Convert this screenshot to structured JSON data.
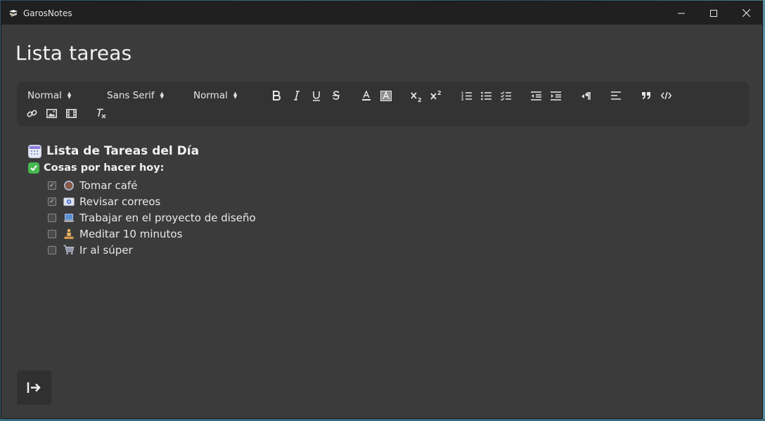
{
  "window": {
    "app_name": "GarosNotes",
    "controls": [
      "minimize",
      "maximize",
      "close"
    ]
  },
  "page_title": "Lista tareas",
  "toolbar": {
    "header_select": "Normal",
    "font_select": "Sans Serif",
    "size_select": "Normal",
    "row1_icons": [
      "bold-icon",
      "italic-icon",
      "underline-icon",
      "strike-icon",
      "text-color-icon",
      "background-color-icon",
      "subscript-icon",
      "superscript-icon",
      "ordered-list-icon",
      "bullet-list-icon",
      "check-list-icon",
      "outdent-icon",
      "indent-icon",
      "rtl-direction-icon",
      "align-icon",
      "blockquote-icon",
      "code-block-icon"
    ],
    "row2_icons": [
      "link-icon",
      "image-icon",
      "video-icon",
      "clear-format-icon"
    ]
  },
  "content": {
    "heading": "Lista de Tareas del Día",
    "heading_emoji": "calendar-icon",
    "subheading": "Cosas por hacer hoy:",
    "subheading_emoji": "check-mark-box-icon",
    "tasks": [
      {
        "label": "Tomar café",
        "checked": true,
        "emoji": "coffee-icon"
      },
      {
        "label": "Revisar correos",
        "checked": true,
        "emoji": "email-icon"
      },
      {
        "label": "Trabajar en el proyecto de diseño",
        "checked": false,
        "emoji": "laptop-icon"
      },
      {
        "label": "Meditar 10 minutos",
        "checked": false,
        "emoji": "meditation-icon"
      },
      {
        "label": "Ir al súper",
        "checked": false,
        "emoji": "shopping-cart-icon"
      }
    ]
  },
  "colors": {
    "window_bg": "#3b3b3b",
    "titlebar_bg": "#202020",
    "toolbar_bg": "#333333",
    "text": "#f0f0f0",
    "check_green": "#45b84f"
  }
}
